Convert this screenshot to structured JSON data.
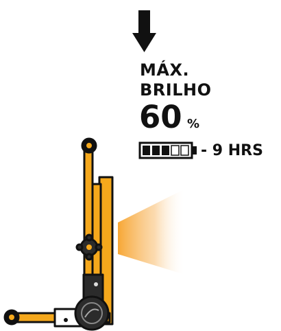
{
  "mode": {
    "line1": "MÁX.",
    "line2": "BRILHO",
    "brightness_value": "60",
    "brightness_unit": "%",
    "runtime": "- 9 HRS"
  },
  "battery": {
    "level_fraction": 0.6,
    "segments_total": 5,
    "segments_filled": 3
  },
  "icons": {
    "arrow": "down-arrow-icon",
    "battery": "battery-icon",
    "device": "work-light-side-view"
  },
  "colors": {
    "text": "#111111",
    "frame": "#f5a81c",
    "outline": "#111111",
    "beam": "#f7a735",
    "knob": "#2b2b2b"
  }
}
